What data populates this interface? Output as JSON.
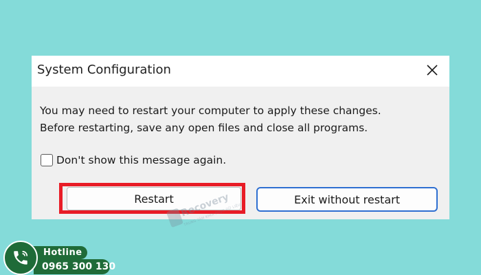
{
  "dialog": {
    "title": "System Configuration",
    "message_line1": "You may need to restart your computer to apply these changes.",
    "message_line2": "Before restarting, save any open files and close all programs.",
    "checkbox_label": "Don't show this message again.",
    "checkbox_checked": false,
    "restart_label": "Restart",
    "exit_label": "Exit without restart"
  },
  "overlay": {
    "watermark_text": "Recovery",
    "watermark_sub": "TRUNG TÂM KHÔI PHỤC DỮ LIỆU",
    "hotline_label": "Hotline",
    "hotline_number": "0965 300 130"
  },
  "colors": {
    "background": "#84dbd9",
    "highlight": "#e81c26",
    "focus_border": "#2e6fd1",
    "hotline_green": "#1f6b38"
  },
  "icons": {
    "close": "close-icon",
    "phone": "phone-icon"
  }
}
